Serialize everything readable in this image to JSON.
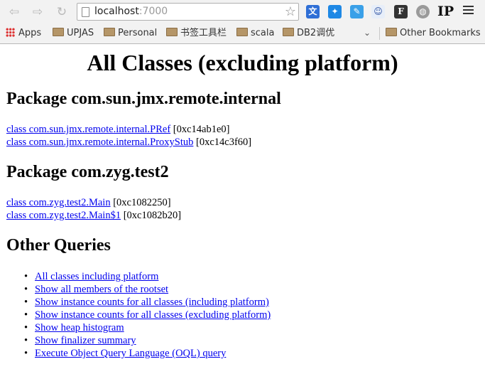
{
  "browser": {
    "url_host": "localhost",
    "url_port": ":7000",
    "bookmarks": [
      "Apps",
      "UPJAS",
      "Personal",
      "书签工具栏",
      "scala",
      "DB2调优"
    ],
    "other_bookmarks": "Other Bookmarks",
    "ip_extension": "IP",
    "icons": [
      "back-icon",
      "forward-icon",
      "reload-icon",
      "page-icon",
      "bookmark-star-icon",
      "translate-icon",
      "extension-blue-icon",
      "extension-note-icon",
      "extension-people-icon",
      "feedly-icon",
      "globe-icon",
      "menu-icon",
      "chevron-down-icon"
    ]
  },
  "page": {
    "title": "All Classes (excluding platform)",
    "packages": [
      {
        "heading": "Package com.sun.jmx.remote.internal",
        "classes": [
          {
            "link": "class com.sun.jmx.remote.internal.PRef",
            "addr": "[0xc14ab1e0]"
          },
          {
            "link": "class com.sun.jmx.remote.internal.ProxyStub",
            "addr": "[0xc14c3f60]"
          }
        ]
      },
      {
        "heading": "Package com.zyg.test2",
        "classes": [
          {
            "link": "class com.zyg.test2.Main",
            "addr": "[0xc1082250]"
          },
          {
            "link": "class com.zyg.test2.Main$1",
            "addr": "[0xc1082b20]"
          }
        ]
      }
    ],
    "other_queries_heading": "Other Queries",
    "queries": [
      "All classes including platform",
      "Show all members of the rootset",
      "Show instance counts for all classes (including platform)",
      "Show instance counts for all classes (excluding platform)",
      "Show heap histogram",
      "Show finalizer summary",
      "Execute Object Query Language (OQL) query"
    ]
  }
}
